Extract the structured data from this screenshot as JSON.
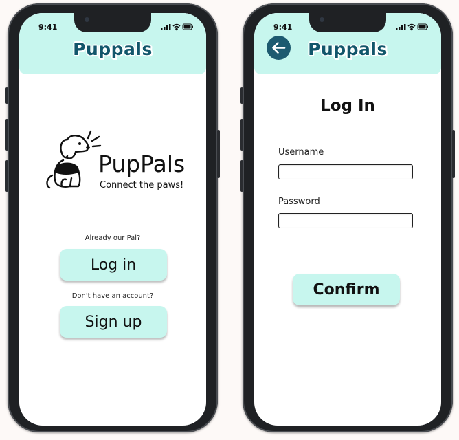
{
  "status_bar": {
    "time": "9:41"
  },
  "app": {
    "logo_text": "uppals",
    "logo_initial": "P"
  },
  "welcome_screen": {
    "brand_name": "PupPals",
    "tagline": "Connect the paws!",
    "login_prompt": "Already our Pal?",
    "login_label": "Log in",
    "signup_prompt": "Don't have an account?",
    "signup_label": "Sign up"
  },
  "login_screen": {
    "heading": "Log In",
    "username_label": "Username",
    "username_value": "",
    "password_label": "Password",
    "password_value": "",
    "confirm_label": "Confirm"
  },
  "colors": {
    "header_bg": "#c7f6ee",
    "button_bg": "#c7f6ee",
    "logo_text": "#12566b",
    "back_button": "#1d5a70",
    "phone_frame": "#1f2124"
  },
  "icons": [
    "dog-logo-icon",
    "back-arrow-icon",
    "signal-icon",
    "wifi-icon",
    "battery-icon",
    "paw-icon"
  ]
}
